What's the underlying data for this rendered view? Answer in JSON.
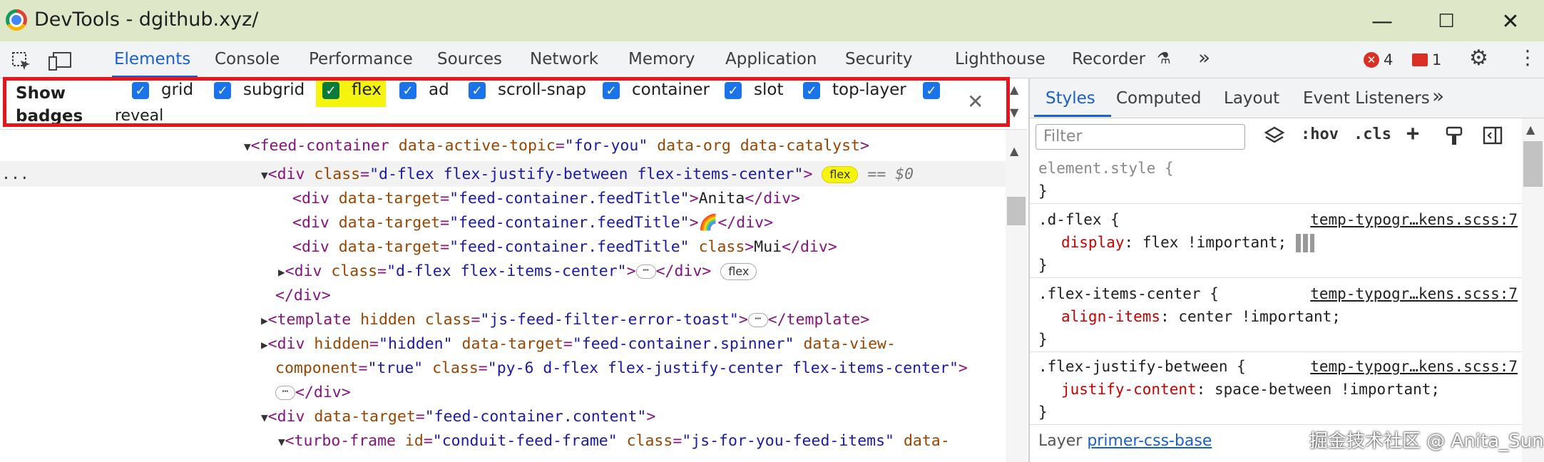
{
  "window": {
    "title": "DevTools - dgithub.xyz/",
    "min": "—",
    "max": "☐",
    "close": "✕"
  },
  "toolbar": {
    "inspect_icon": "inspect-icon",
    "device_icon": "device-toolbar-icon",
    "tabs": [
      "Elements",
      "Console",
      "Performance",
      "Sources",
      "Network",
      "Memory",
      "Application",
      "Security",
      "Lighthouse",
      "Recorder"
    ],
    "more": "»",
    "errors": "4",
    "issues": "1",
    "settings": "⚙",
    "menu": "⋮"
  },
  "badges": {
    "label_line1": "Show",
    "label_line2": "badges",
    "items": [
      "grid",
      "subgrid",
      "flex",
      "ad",
      "scroll-snap",
      "container",
      "slot",
      "top-layer"
    ],
    "wrap_item": "reveal",
    "close": "✕"
  },
  "dom": {
    "l1": {
      "tag_open": "<feed-container ",
      "a1": "data-active-topic",
      "eq": "=",
      "v1": "\"for-you\"",
      "a2": " data-org data-catalyst",
      "close": ">"
    },
    "l2": {
      "tag_open": "<div ",
      "a1": "class",
      "v1": "\"d-flex flex-justify-between flex-items-center\"",
      "close": ">",
      "badge": "flex",
      "ref": "== $0"
    },
    "l3": {
      "tag_open": "<div ",
      "a1": "data-target",
      "v1": "\"feed-container.feedTitle\"",
      "close": ">",
      "text": "Anita",
      "end": "</div>"
    },
    "l4": {
      "tag_open": "<div ",
      "a1": "data-target",
      "v1": "\"feed-container.feedTitle\"",
      "close": ">",
      "text": "🌈",
      "end": "</div>"
    },
    "l5": {
      "tag_open": "<div ",
      "a1": "data-target",
      "v1": "\"feed-container.feedTitle\"",
      "a2": " class",
      "close": ">",
      "text": "Mui",
      "end": "</div>"
    },
    "l6": {
      "tag_open": "<div ",
      "a1": "class",
      "v1": "\"d-flex flex-items-center\"",
      "close": ">",
      "ell": "⋯",
      "end": "</div>",
      "badge": "flex"
    },
    "l7": {
      "end": "</div>"
    },
    "l8": {
      "tag_open": "<template ",
      "a1": "hidden",
      "a2": " class",
      "v2": "\"js-feed-filter-error-toast\"",
      "close": ">",
      "ell": "⋯",
      "end": "</template>"
    },
    "l9": {
      "tag_open": "<div ",
      "a1": "hidden",
      "v1": "\"hidden\"",
      "a2": " data-target",
      "v2": "\"feed-container.spinner\"",
      "a3": " data-view-"
    },
    "l10": {
      "a1": "component",
      "v1": "\"true\"",
      "a2": " class",
      "v2": "\"py-6 d-flex flex-justify-center flex-items-center\"",
      "close": ">"
    },
    "l11": {
      "ell": "⋯",
      "end": "</div>"
    },
    "l12": {
      "tag_open": "<div ",
      "a1": "data-target",
      "v1": "\"feed-container.content\"",
      "close": ">"
    },
    "l13": {
      "tag_open": "<turbo-frame ",
      "a1": "id",
      "v1": "\"conduit-feed-frame\"",
      "a2": " class",
      "v2": "\"js-for-you-feed-items\"",
      "a3": " data-"
    },
    "dots": "..."
  },
  "styles": {
    "tabs": [
      "Styles",
      "Computed",
      "Layout",
      "Event Listeners"
    ],
    "more": "»",
    "filter_placeholder": "Filter",
    "hov": ":hov",
    "cls": ".cls",
    "plus": "+",
    "rules": [
      {
        "selector": "element.style {",
        "end": "}"
      },
      {
        "selector": ".d-flex {",
        "source": "temp-typogr…kens.scss:7",
        "prop": "display",
        "value": "flex !important;",
        "end": "}"
      },
      {
        "selector": ".flex-items-center {",
        "source": "temp-typogr…kens.scss:7",
        "prop": "align-items",
        "value": "center !important;",
        "end": "}"
      },
      {
        "selector": ".flex-justify-between {",
        "source": "temp-typogr…kens.scss:7",
        "prop": "justify-content",
        "value": "space-between !important;",
        "end": "}"
      }
    ],
    "layer_label": "Layer",
    "layer_link": "primer-css-base"
  },
  "watermark": "掘金技术社区 @ Anita_Sun",
  "colors": {
    "accent": "#1a5fd0",
    "highlight": "#f4f40f",
    "redbox": "#e6151d"
  }
}
